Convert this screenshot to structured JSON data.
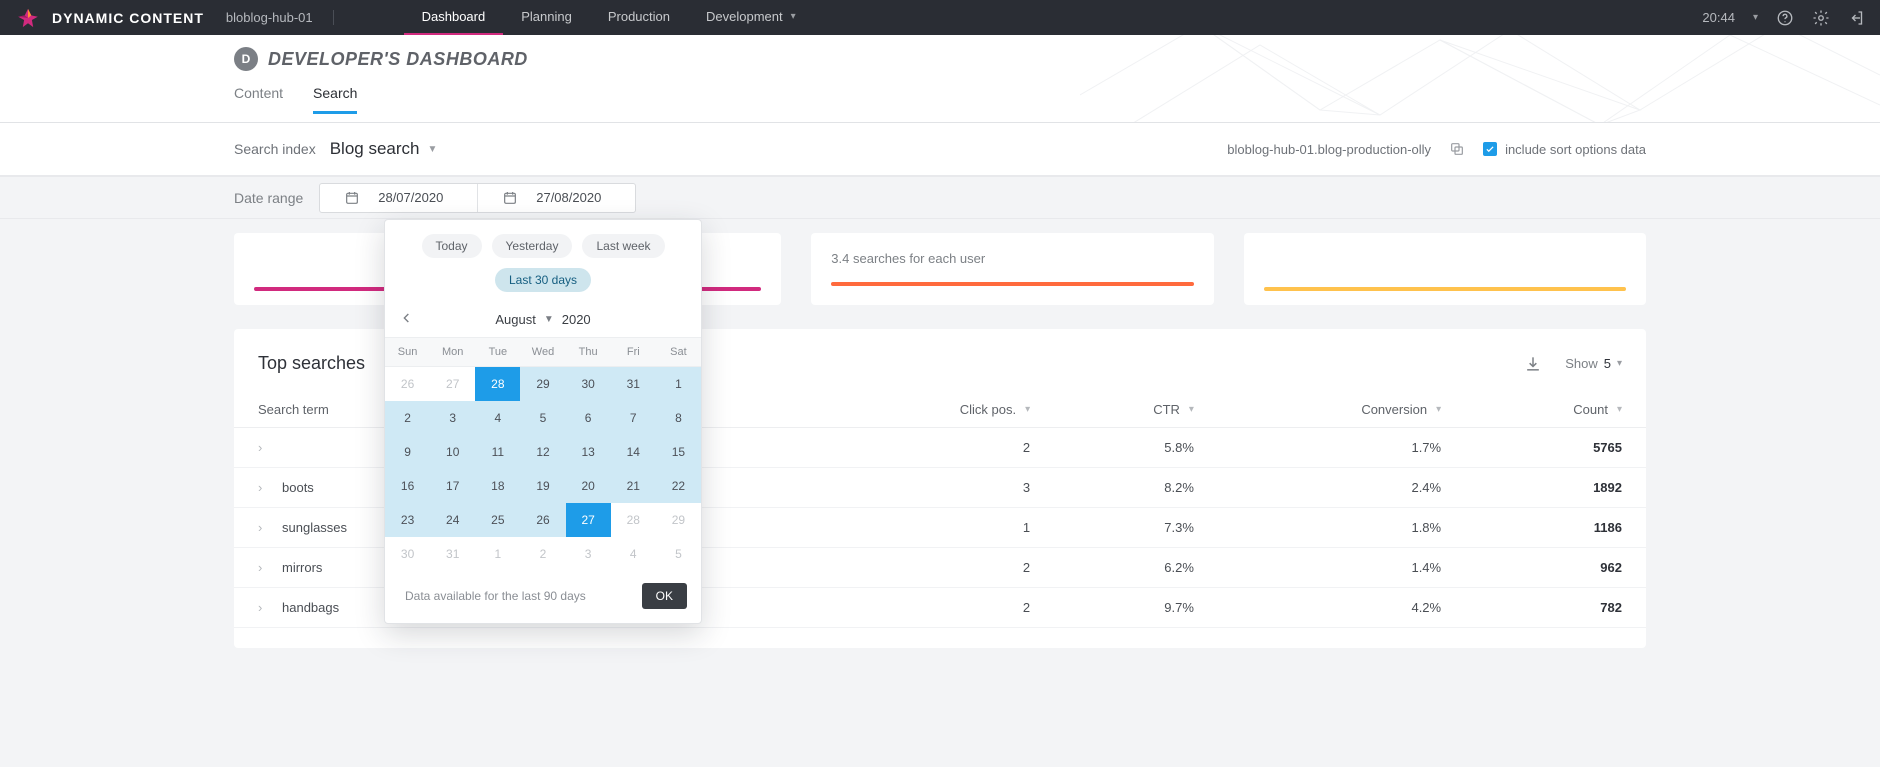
{
  "topbar": {
    "brand": "DYNAMIC CONTENT",
    "hub": "bloblog-hub-01",
    "nav": [
      {
        "label": "Dashboard",
        "active": true
      },
      {
        "label": "Planning",
        "active": false
      },
      {
        "label": "Production",
        "active": false
      },
      {
        "label": "Development",
        "active": false
      }
    ],
    "time": "20:44"
  },
  "header": {
    "badge_letter": "D",
    "title": "DEVELOPER'S DASHBOARD",
    "subtabs": [
      {
        "label": "Content",
        "active": false
      },
      {
        "label": "Search",
        "active": true
      }
    ]
  },
  "filter": {
    "index_label": "Search index",
    "index_value": "Blog search",
    "index_name": "bloblog-hub-01.blog-production-olly",
    "include_sort_label": "include sort options data",
    "include_sort_checked": true
  },
  "daterange": {
    "label": "Date range",
    "start": "28/07/2020",
    "end": "27/08/2020"
  },
  "summary": {
    "per_user": "3.4 searches for each user"
  },
  "picker": {
    "quick": [
      {
        "label": "Today",
        "active": false
      },
      {
        "label": "Yesterday",
        "active": false
      },
      {
        "label": "Last week",
        "active": false
      },
      {
        "label": "Last 30 days",
        "active": true
      }
    ],
    "month": "August",
    "year": "2020",
    "dow": [
      "Sun",
      "Mon",
      "Tue",
      "Wed",
      "Thu",
      "Fri",
      "Sat"
    ],
    "weeks": [
      [
        {
          "d": "26",
          "state": "other"
        },
        {
          "d": "27",
          "state": "other"
        },
        {
          "d": "28",
          "state": "endpoint"
        },
        {
          "d": "29",
          "state": "inrange"
        },
        {
          "d": "30",
          "state": "inrange"
        },
        {
          "d": "31",
          "state": "inrange"
        },
        {
          "d": "1",
          "state": "inrange"
        }
      ],
      [
        {
          "d": "2",
          "state": "inrange"
        },
        {
          "d": "3",
          "state": "inrange"
        },
        {
          "d": "4",
          "state": "inrange"
        },
        {
          "d": "5",
          "state": "inrange"
        },
        {
          "d": "6",
          "state": "inrange"
        },
        {
          "d": "7",
          "state": "inrange"
        },
        {
          "d": "8",
          "state": "inrange"
        }
      ],
      [
        {
          "d": "9",
          "state": "inrange"
        },
        {
          "d": "10",
          "state": "inrange"
        },
        {
          "d": "11",
          "state": "inrange"
        },
        {
          "d": "12",
          "state": "inrange"
        },
        {
          "d": "13",
          "state": "inrange"
        },
        {
          "d": "14",
          "state": "inrange"
        },
        {
          "d": "15",
          "state": "inrange"
        }
      ],
      [
        {
          "d": "16",
          "state": "inrange"
        },
        {
          "d": "17",
          "state": "inrange"
        },
        {
          "d": "18",
          "state": "inrange"
        },
        {
          "d": "19",
          "state": "inrange"
        },
        {
          "d": "20",
          "state": "inrange"
        },
        {
          "d": "21",
          "state": "inrange"
        },
        {
          "d": "22",
          "state": "inrange"
        }
      ],
      [
        {
          "d": "23",
          "state": "inrange"
        },
        {
          "d": "24",
          "state": "inrange"
        },
        {
          "d": "25",
          "state": "inrange"
        },
        {
          "d": "26",
          "state": "inrange"
        },
        {
          "d": "27",
          "state": "endpoint"
        },
        {
          "d": "28",
          "state": "other"
        },
        {
          "d": "29",
          "state": "other"
        }
      ],
      [
        {
          "d": "30",
          "state": "other"
        },
        {
          "d": "31",
          "state": "other"
        },
        {
          "d": "1",
          "state": "other"
        },
        {
          "d": "2",
          "state": "other"
        },
        {
          "d": "3",
          "state": "other"
        },
        {
          "d": "4",
          "state": "other"
        },
        {
          "d": "5",
          "state": "other"
        }
      ]
    ],
    "footer_note": "Data available for the last 90 days",
    "ok_label": "OK"
  },
  "table": {
    "title": "Top searches",
    "show_label": "Show",
    "show_value": "5",
    "columns": {
      "term": "Search term",
      "click": "Click pos.",
      "ctr": "CTR",
      "conv": "Conversion",
      "count": "Count"
    },
    "rows": [
      {
        "term": "",
        "click": "2",
        "ctr": "5.8%",
        "conv": "1.7%",
        "count": "5765"
      },
      {
        "term": "boots",
        "click": "3",
        "ctr": "8.2%",
        "conv": "2.4%",
        "count": "1892"
      },
      {
        "term": "sunglasses",
        "click": "1",
        "ctr": "7.3%",
        "conv": "1.8%",
        "count": "1186"
      },
      {
        "term": "mirrors",
        "click": "2",
        "ctr": "6.2%",
        "conv": "1.4%",
        "count": "962"
      },
      {
        "term": "handbags",
        "click": "2",
        "ctr": "9.7%",
        "conv": "4.2%",
        "count": "782"
      }
    ]
  }
}
